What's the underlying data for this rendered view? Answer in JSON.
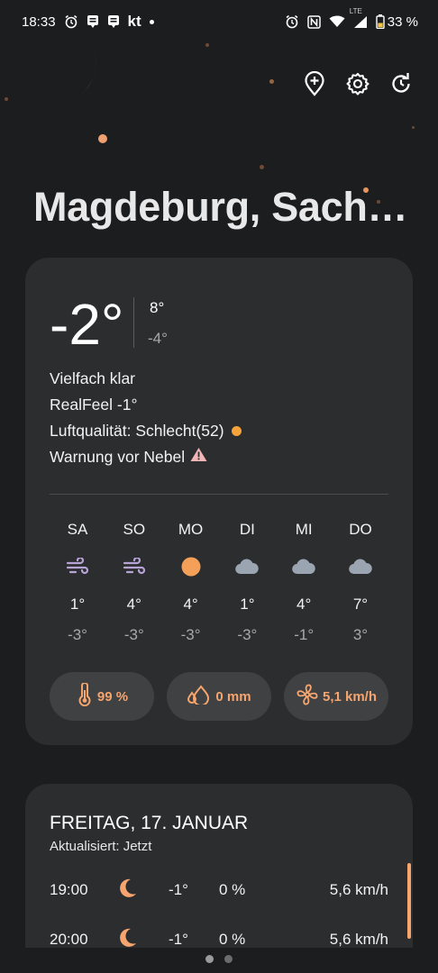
{
  "status_bar": {
    "time": "18:33",
    "carrier_text": "kt",
    "network": "LTE",
    "battery": "33 %"
  },
  "city": "Magdeburg, Sach…",
  "current": {
    "temp": "-2°",
    "high": "8°",
    "low": "-4°",
    "condition": "Vielfach klar",
    "realfeel": "RealFeel -1°",
    "air_quality": "Luftqualität: Schlecht(52)",
    "warning": "Warnung vor Nebel"
  },
  "forecast": [
    {
      "day": "SA",
      "icon": "wind-icon",
      "high": "1°",
      "low": "-3°"
    },
    {
      "day": "SO",
      "icon": "wind-icon",
      "high": "4°",
      "low": "-3°"
    },
    {
      "day": "MO",
      "icon": "sun-icon",
      "high": "4°",
      "low": "-3°"
    },
    {
      "day": "DI",
      "icon": "cloud-icon",
      "high": "1°",
      "low": "-3°"
    },
    {
      "day": "MI",
      "icon": "cloud-icon",
      "high": "4°",
      "low": "-1°"
    },
    {
      "day": "DO",
      "icon": "cloud-icon",
      "high": "7°",
      "low": "3°"
    }
  ],
  "pills": {
    "humidity": "99 %",
    "precipitation": "0 mm",
    "wind": "5,1 km/h"
  },
  "hourly": {
    "date_title": "FREITAG, 17. JANUAR",
    "updated": "Aktualisiert: Jetzt",
    "rows": [
      {
        "time": "19:00",
        "icon": "moon-icon",
        "temp": "-1°",
        "precip": "0 %",
        "wind": "5,6 km/h"
      },
      {
        "time": "20:00",
        "icon": "moon-icon",
        "temp": "-1°",
        "precip": "0 %",
        "wind": "5,6 km/h"
      }
    ]
  },
  "colors": {
    "background": "#1c1d1f",
    "card": "#2c2d2f",
    "accent": "#f5a56d",
    "moon": "#fbb887"
  }
}
